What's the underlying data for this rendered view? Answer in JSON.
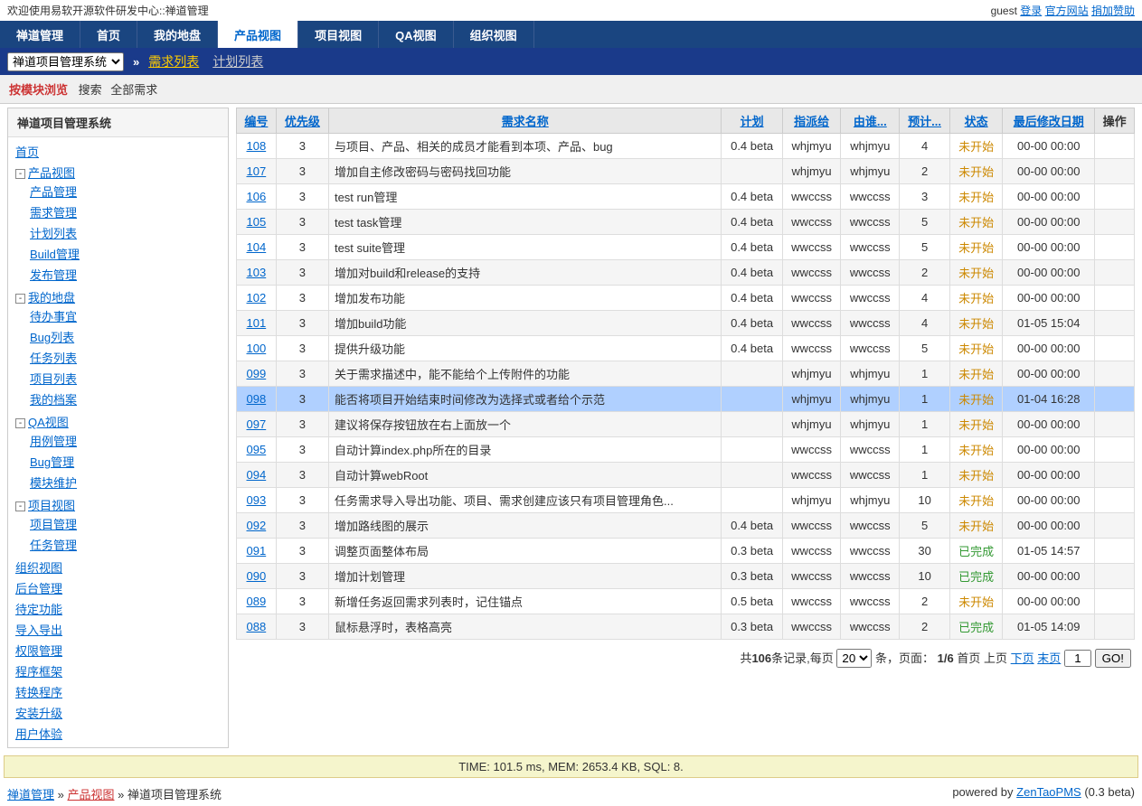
{
  "topbar": {
    "welcome": "欢迎使用易软开源软件研发中心::禅道管理",
    "user": "guest",
    "login": "登录",
    "official": "官方网站",
    "donate": "捐加赞助"
  },
  "tabs": [
    "禅道管理",
    "首页",
    "我的地盘",
    "产品视图",
    "项目视图",
    "QA视图",
    "组织视图"
  ],
  "active_tab": 3,
  "subnav": {
    "select": "禅道项目管理系统",
    "arrow": "»",
    "links": [
      {
        "label": "需求列表",
        "active": true
      },
      {
        "label": "计划列表",
        "active": false
      }
    ]
  },
  "filter": {
    "label": "按模块浏览",
    "search": "搜索",
    "all": "全部需求"
  },
  "sidebar": {
    "title": "禅道项目管理系统",
    "tree": [
      {
        "label": "首页",
        "children": null,
        "expand": null
      },
      {
        "label": "产品视图",
        "expand": "-",
        "children": [
          {
            "label": "产品管理"
          },
          {
            "label": "需求管理"
          },
          {
            "label": "计划列表"
          },
          {
            "label": "Build管理"
          },
          {
            "label": "发布管理"
          }
        ]
      },
      {
        "label": "我的地盘",
        "expand": "-",
        "children": [
          {
            "label": "待办事宜"
          },
          {
            "label": "Bug列表"
          },
          {
            "label": "任务列表"
          },
          {
            "label": "项目列表"
          },
          {
            "label": "我的档案"
          }
        ]
      },
      {
        "label": "QA视图",
        "expand": "-",
        "children": [
          {
            "label": "用例管理"
          },
          {
            "label": "Bug管理"
          },
          {
            "label": "模块维护"
          }
        ]
      },
      {
        "label": "项目视图",
        "expand": "-",
        "children": [
          {
            "label": "项目管理"
          },
          {
            "label": "任务管理"
          }
        ]
      },
      {
        "label": "组织视图",
        "children": null,
        "expand": null
      },
      {
        "label": "后台管理",
        "children": null,
        "expand": null
      },
      {
        "label": "待定功能",
        "children": null,
        "expand": null
      },
      {
        "label": "导入导出",
        "children": null,
        "expand": null
      },
      {
        "label": "权限管理",
        "children": null,
        "expand": null
      },
      {
        "label": "程序框架",
        "children": null,
        "expand": null
      },
      {
        "label": "转换程序",
        "children": null,
        "expand": null
      },
      {
        "label": "安装升级",
        "children": null,
        "expand": null
      },
      {
        "label": "用户体验",
        "children": null,
        "expand": null
      }
    ]
  },
  "table": {
    "headers": [
      "编号",
      "优先级",
      "需求名称",
      "计划",
      "指派给",
      "由谁...",
      "预计...",
      "状态",
      "最后修改日期",
      "操作"
    ],
    "rows": [
      {
        "id": "108",
        "pri": "3",
        "title": "与项目、产品、相关的成员才能看到本项、产品、bug",
        "plan": "0.4 beta",
        "assign": "whjmyu",
        "by": "whjmyu",
        "est": "4",
        "status": "未开始",
        "date": "00-00 00:00"
      },
      {
        "id": "107",
        "pri": "3",
        "title": "增加自主修改密码与密码找回功能",
        "plan": "",
        "assign": "whjmyu",
        "by": "whjmyu",
        "est": "2",
        "status": "未开始",
        "date": "00-00 00:00"
      },
      {
        "id": "106",
        "pri": "3",
        "title": "test run管理",
        "plan": "0.4 beta",
        "assign": "wwccss",
        "by": "wwccss",
        "est": "3",
        "status": "未开始",
        "date": "00-00 00:00"
      },
      {
        "id": "105",
        "pri": "3",
        "title": "test task管理",
        "plan": "0.4 beta",
        "assign": "wwccss",
        "by": "wwccss",
        "est": "5",
        "status": "未开始",
        "date": "00-00 00:00"
      },
      {
        "id": "104",
        "pri": "3",
        "title": "test suite管理",
        "plan": "0.4 beta",
        "assign": "wwccss",
        "by": "wwccss",
        "est": "5",
        "status": "未开始",
        "date": "00-00 00:00"
      },
      {
        "id": "103",
        "pri": "3",
        "title": "增加对build和release的支持",
        "plan": "0.4 beta",
        "assign": "wwccss",
        "by": "wwccss",
        "est": "2",
        "status": "未开始",
        "date": "00-00 00:00"
      },
      {
        "id": "102",
        "pri": "3",
        "title": "增加发布功能",
        "plan": "0.4 beta",
        "assign": "wwccss",
        "by": "wwccss",
        "est": "4",
        "status": "未开始",
        "date": "00-00 00:00"
      },
      {
        "id": "101",
        "pri": "3",
        "title": "增加build功能",
        "plan": "0.4 beta",
        "assign": "wwccss",
        "by": "wwccss",
        "est": "4",
        "status": "未开始",
        "date": "01-05 15:04"
      },
      {
        "id": "100",
        "pri": "3",
        "title": "提供升级功能",
        "plan": "0.4 beta",
        "assign": "wwccss",
        "by": "wwccss",
        "est": "5",
        "status": "未开始",
        "date": "00-00 00:00"
      },
      {
        "id": "099",
        "pri": "3",
        "title": "关于需求描述中，能不能给个上传附件的功能",
        "plan": "",
        "assign": "whjmyu",
        "by": "whjmyu",
        "est": "1",
        "status": "未开始",
        "date": "00-00 00:00"
      },
      {
        "id": "098",
        "pri": "3",
        "title": "能否将项目开始结束时间修改为选择式或者给个示范",
        "plan": "",
        "assign": "whjmyu",
        "by": "whjmyu",
        "est": "1",
        "status": "未开始",
        "date": "01-04 16:28",
        "hl": true
      },
      {
        "id": "097",
        "pri": "3",
        "title": "建议将保存按钮放在右上面放一个",
        "plan": "",
        "assign": "whjmyu",
        "by": "whjmyu",
        "est": "1",
        "status": "未开始",
        "date": "00-00 00:00"
      },
      {
        "id": "095",
        "pri": "3",
        "title": "自动计算index.php所在的目录",
        "plan": "",
        "assign": "wwccss",
        "by": "wwccss",
        "est": "1",
        "status": "未开始",
        "date": "00-00 00:00"
      },
      {
        "id": "094",
        "pri": "3",
        "title": "自动计算webRoot",
        "plan": "",
        "assign": "wwccss",
        "by": "wwccss",
        "est": "1",
        "status": "未开始",
        "date": "00-00 00:00"
      },
      {
        "id": "093",
        "pri": "3",
        "title": "任务需求导入导出功能、项目、需求创建应该只有项目管理角色...",
        "plan": "",
        "assign": "whjmyu",
        "by": "whjmyu",
        "est": "10",
        "status": "未开始",
        "date": "00-00 00:00"
      },
      {
        "id": "092",
        "pri": "3",
        "title": "增加路线图的展示",
        "plan": "0.4 beta",
        "assign": "wwccss",
        "by": "wwccss",
        "est": "5",
        "status": "未开始",
        "date": "00-00 00:00"
      },
      {
        "id": "091",
        "pri": "3",
        "title": "调整页面整体布局",
        "plan": "0.3 beta",
        "assign": "wwccss",
        "by": "wwccss",
        "est": "30",
        "status": "已完成",
        "date": "01-05 14:57"
      },
      {
        "id": "090",
        "pri": "3",
        "title": "增加计划管理",
        "plan": "0.3 beta",
        "assign": "wwccss",
        "by": "wwccss",
        "est": "10",
        "status": "已完成",
        "date": "00-00 00:00"
      },
      {
        "id": "089",
        "pri": "3",
        "title": "新增任务返回需求列表时，记住锚点",
        "plan": "0.5 beta",
        "assign": "wwccss",
        "by": "wwccss",
        "est": "2",
        "status": "未开始",
        "date": "00-00 00:00"
      },
      {
        "id": "088",
        "pri": "3",
        "title": "鼠标悬浮时，表格高亮",
        "plan": "0.3 beta",
        "assign": "wwccss",
        "by": "wwccss",
        "est": "2",
        "status": "已完成",
        "date": "01-05 14:09"
      }
    ]
  },
  "pager": {
    "total_prefix": "共",
    "total": "106",
    "total_suffix": "条记录,每页",
    "per_page": "20",
    "suffix2": "条，页面：",
    "page": "1/6",
    "first": "首页",
    "prev": "上页",
    "next": "下页",
    "last": "末页",
    "page_input": "1",
    "go": "GO!"
  },
  "footer_stats": "TIME: 101.5 ms, MEM: 2653.4 KB, SQL: 8.",
  "breadcrumb": {
    "a": "禅道管理",
    "sep": "»",
    "b": "产品视图",
    "c": "禅道项目管理系统",
    "powered": "powered by",
    "pms": "ZenTaoPMS",
    "ver": "(0.3 beta)"
  }
}
